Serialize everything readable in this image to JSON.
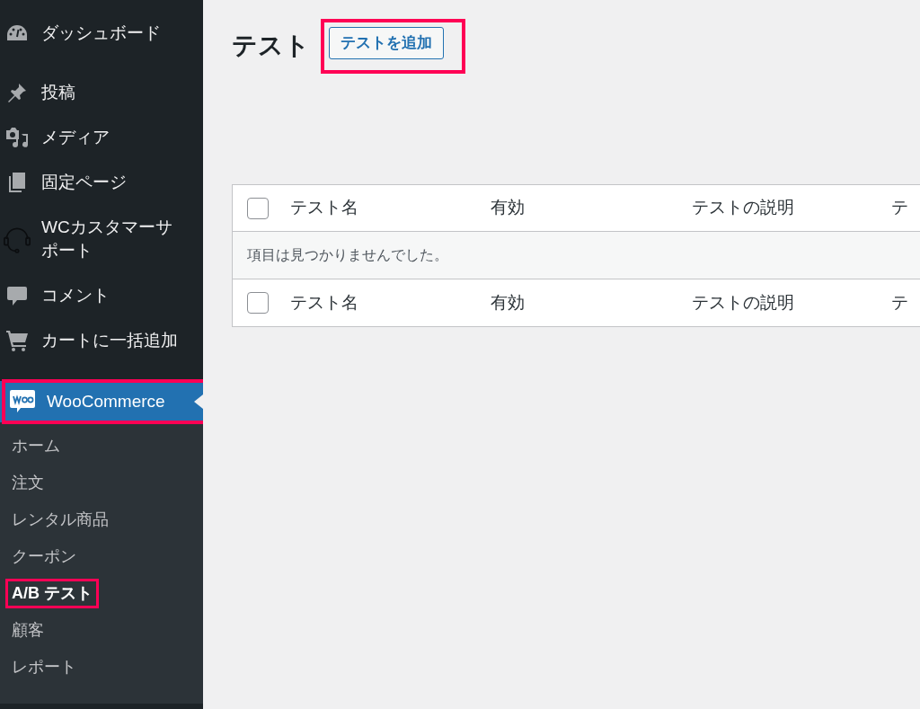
{
  "sidebar": {
    "items": [
      {
        "label": "ダッシュボード",
        "selected": false,
        "highlighted": false
      },
      {
        "label": "投稿",
        "selected": false,
        "highlighted": false
      },
      {
        "label": "メディア",
        "selected": false,
        "highlighted": false
      },
      {
        "label": "固定ページ",
        "selected": false,
        "highlighted": false
      },
      {
        "label": "WCカスタマーサポート",
        "selected": false,
        "highlighted": false
      },
      {
        "label": "コメント",
        "selected": false,
        "highlighted": false
      },
      {
        "label": "カートに一括追加",
        "selected": false,
        "highlighted": false
      },
      {
        "label": "WooCommerce",
        "selected": true,
        "highlighted": true,
        "children": [
          {
            "label": "ホーム",
            "selected": false,
            "highlighted": false
          },
          {
            "label": "注文",
            "selected": false,
            "highlighted": false
          },
          {
            "label": "レンタル商品",
            "selected": false,
            "highlighted": false
          },
          {
            "label": "クーポン",
            "selected": false,
            "highlighted": false
          },
          {
            "label": "A/B テスト",
            "selected": true,
            "highlighted": true
          },
          {
            "label": "顧客",
            "selected": false,
            "highlighted": false
          },
          {
            "label": "レポート",
            "selected": false,
            "highlighted": false
          }
        ]
      }
    ]
  },
  "page": {
    "title": "テスト",
    "add_button": {
      "label": "テストを追加",
      "highlighted": true
    }
  },
  "table": {
    "header_columns": [
      "テスト名",
      "有効",
      "テストの説明",
      "テ"
    ],
    "footer_columns": [
      "テスト名",
      "有効",
      "テストの説明",
      "テ"
    ],
    "header_checkbox": {
      "checked": false
    },
    "footer_checkbox": {
      "checked": false
    },
    "empty_message": "項目は見つかりませんでした。"
  }
}
